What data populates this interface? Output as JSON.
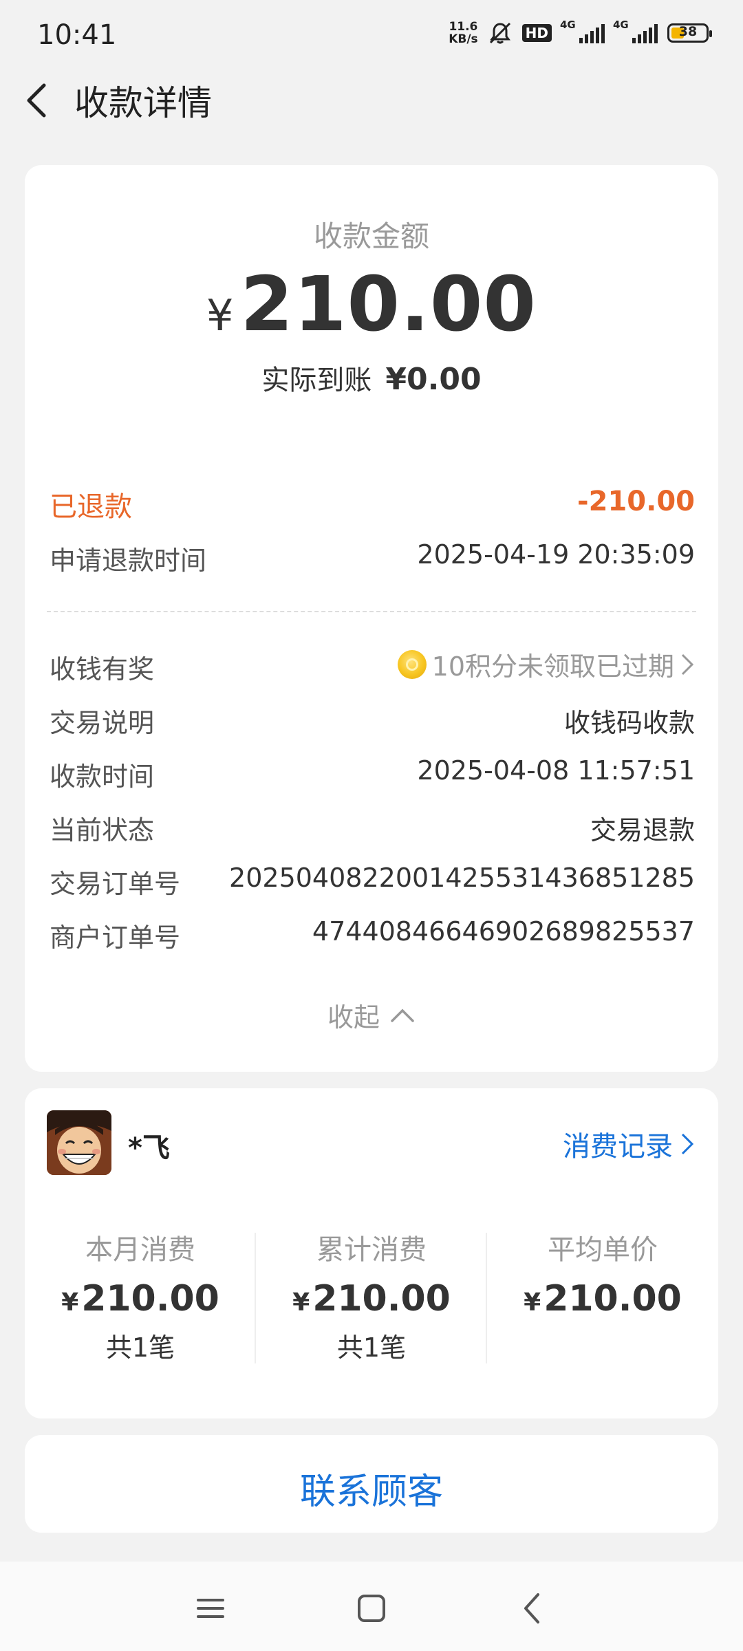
{
  "status_bar": {
    "time": "10:41",
    "speed_value": "11.6",
    "speed_unit": "KB/s",
    "hd_badge": "HD",
    "network1": "4G",
    "network2": "4G",
    "battery": "38"
  },
  "header": {
    "title": "收款详情"
  },
  "summary": {
    "amount_label": "收款金额",
    "currency": "¥",
    "amount": "210.00",
    "received_label": "实际到账",
    "received_value": "¥0.00"
  },
  "refund": {
    "status": "已退款",
    "amount": "-210.00",
    "time_label": "申请退款时间",
    "time_value": "2025-04-19 20:35:09"
  },
  "details": {
    "reward_label": "收钱有奖",
    "reward_value": "10积分未领取已过期",
    "desc_label": "交易说明",
    "desc_value": "收钱码收款",
    "time_label": "收款时间",
    "time_value": "2025-04-08 11:57:51",
    "state_label": "当前状态",
    "state_value": "交易退款",
    "order_label": "交易订单号",
    "order_value": "2025040822001425531436851285",
    "merchant_order_label": "商户订单号",
    "merchant_order_value": "47440846646902689825537",
    "collapse_label": "收起"
  },
  "customer": {
    "name": "*飞",
    "records_link": "消费记录",
    "stats": [
      {
        "label": "本月消费",
        "currency": "¥",
        "value": "210.00",
        "count": "共1笔"
      },
      {
        "label": "累计消费",
        "currency": "¥",
        "value": "210.00",
        "count": "共1笔"
      },
      {
        "label": "平均单价",
        "currency": "¥",
        "value": "210.00"
      }
    ]
  },
  "contact_button": "联系顾客",
  "navbar": {
    "icons": [
      "menu-icon",
      "home-square-icon",
      "back-triangle-icon"
    ]
  },
  "colors": {
    "accent_blue": "#1a73d9",
    "refund_orange": "#e8672a",
    "coin_gold": "#f7c520"
  }
}
